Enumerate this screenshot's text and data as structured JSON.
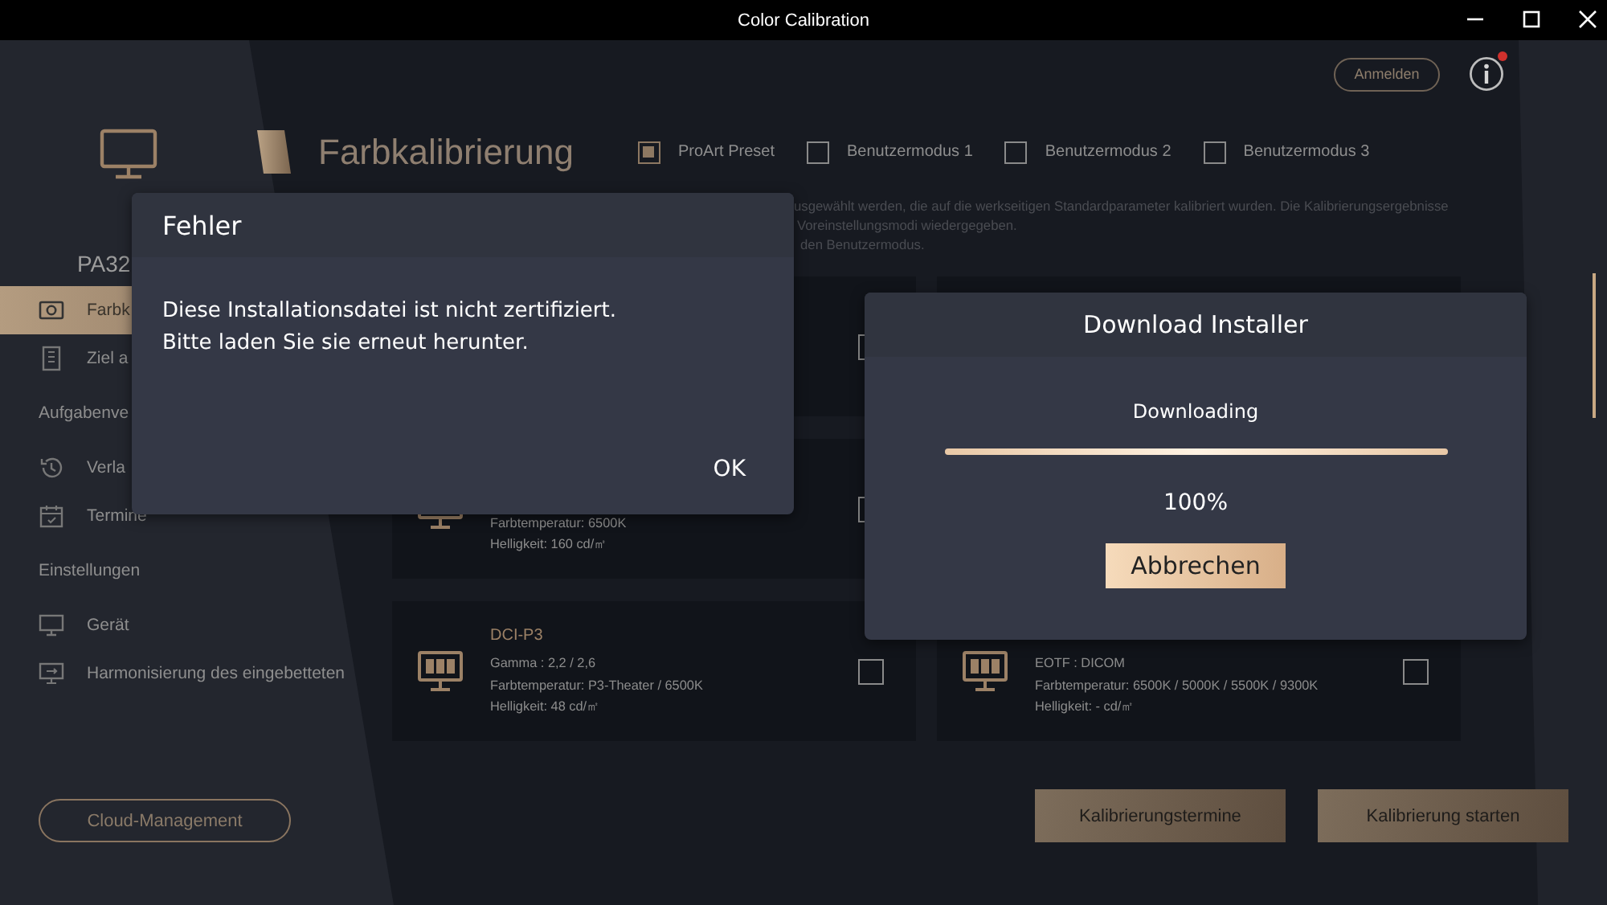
{
  "window": {
    "title": "Color Calibration"
  },
  "sidebar": {
    "device_name": "PA32",
    "items": [
      {
        "kind": "camera",
        "label": "Farbk",
        "selected": true
      },
      {
        "kind": "document",
        "label": "Ziel a",
        "selected": false
      },
      {
        "kind": "section",
        "label": "Aufgabenve"
      },
      {
        "kind": "history",
        "label": "Verla",
        "selected": false
      },
      {
        "kind": "calendar",
        "label": "Termine",
        "selected": false
      },
      {
        "kind": "section",
        "label": "Einstellungen"
      },
      {
        "kind": "monitor",
        "label": "Gerät",
        "selected": false
      },
      {
        "kind": "monitor-sync",
        "label": "Harmonisierung des eingebetteten",
        "selected": false
      }
    ],
    "cloud_button": "Cloud-Management"
  },
  "header": {
    "login_button": "Anmelden",
    "notification": true,
    "title": "Farbkalibrierung",
    "modes": [
      {
        "label": "ProArt Preset",
        "checked": true
      },
      {
        "label": "Benutzermodus 1",
        "checked": false
      },
      {
        "label": "Benutzermodus 2",
        "checked": false
      },
      {
        "label": "Benutzermodus 3",
        "checked": false
      }
    ]
  },
  "description": [
    "usgewählt werden, die auf die werkseitigen Standardparameter kalibriert wurden. Die Kalibrierungsergebnisse",
    "Voreinstellungsmodi wiedergegeben.",
    "den Benutzermodus."
  ],
  "card_rows": [
    [
      {
        "checked": false
      }
    ],
    [
      {
        "lines": [
          "Farbtemperatur: 6500K",
          "Helligkeit: 160 cd/㎡"
        ],
        "checked": false
      }
    ],
    [
      {
        "title": "DCI-P3",
        "lines": [
          "Gamma : 2,2 / 2,6",
          "Farbtemperatur: P3-Theater / 6500K",
          "Helligkeit: 48 cd/㎡"
        ],
        "checked": false
      },
      {
        "lines": [
          "EOTF : DICOM",
          "Farbtemperatur: 6500K / 5000K / 5500K / 9300K",
          "Helligkeit: - cd/㎡"
        ],
        "checked": false
      }
    ]
  ],
  "buttons": [
    "Kalibrierungstermine",
    "Kalibrierung starten"
  ],
  "error_dialog": {
    "title": "Fehler",
    "message": [
      "Diese Installationsdatei ist nicht zertifiziert.",
      "Bitte laden Sie sie erneut herunter."
    ],
    "ok": "OK"
  },
  "download_dialog": {
    "title": "Download Installer",
    "status": "Downloading",
    "level": 1,
    "percent": "100%",
    "cancel": "Abbrechen"
  }
}
